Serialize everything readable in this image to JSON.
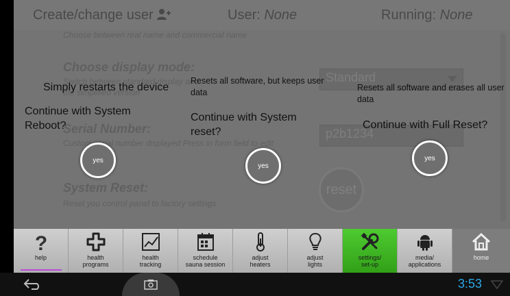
{
  "header": {
    "create_user": "Create/change user",
    "user_label": "User:",
    "user_value": "None",
    "running_label": "Running:",
    "running_value": "None"
  },
  "background_panel": {
    "top_desc": "Choose between real name and commercial name",
    "display_mode_heading": "Choose display mode:",
    "display_mode_desc": "Switch between standard display and",
    "display_mode_desc2": "the simplified version",
    "display_mode_value": "Standard",
    "serial_heading": "Serial Number:",
    "serial_desc": "Custom serial number displayed Press in form field to edit",
    "serial_value": "p2b1234",
    "system_reset_heading": "System Reset:",
    "system_reset_desc": "Reset you control panel to factory settings",
    "reset_button": "reset"
  },
  "dialog": {
    "reboot": {
      "desc": "Simply restarts the device",
      "question": "Continue with System Reboot?",
      "button": "yes"
    },
    "system_reset": {
      "desc": "Resets all software, but keeps user data",
      "question": "Continue with System reset?",
      "button": "yes"
    },
    "full_reset": {
      "desc": "Resets all software and erases all user data",
      "question": "Continue with Full Reset?",
      "button": "yes"
    }
  },
  "toolbar": [
    {
      "label": "help",
      "icon": "help-icon"
    },
    {
      "label": "health\nprograms",
      "icon": "health-cross-icon"
    },
    {
      "label": "health\ntracking",
      "icon": "chart-icon"
    },
    {
      "label": "schedule\nsauna session",
      "icon": "calendar-icon"
    },
    {
      "label": "adjust\nheaters",
      "icon": "thermometer-icon"
    },
    {
      "label": "adjust\nlights",
      "icon": "lightbulb-icon"
    },
    {
      "label": "settings/\nset-up",
      "icon": "tools-icon"
    },
    {
      "label": "media/\napplications",
      "icon": "android-icon"
    },
    {
      "label": "home",
      "icon": "home-icon"
    }
  ],
  "status_bar": {
    "time": "3:53"
  },
  "colors": {
    "accent_green": "#3cb521",
    "clock_blue": "#2aa8e6",
    "help_underline": "#b84ad8"
  }
}
